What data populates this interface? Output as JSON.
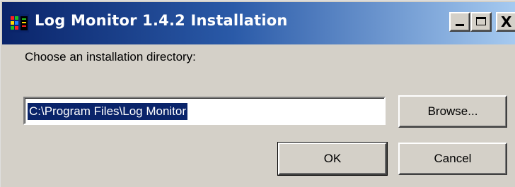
{
  "window": {
    "title": "Log Monitor 1.4.2 Installation",
    "icon": "app-icon",
    "controls": {
      "minimize_icon": "minimize-icon",
      "maximize_icon": "maximize-icon",
      "close_icon": "close-icon",
      "close_glyph": "X"
    }
  },
  "dialog": {
    "prompt": "Choose an installation directory:",
    "directory_value": "C:\\Program Files\\Log Monitor",
    "browse_label": "Browse...",
    "ok_label": "OK",
    "cancel_label": "Cancel"
  },
  "colors": {
    "titlebar_start": "#0a246a",
    "titlebar_end": "#a6caf0",
    "face": "#d4d0c8",
    "selection": "#0a246a"
  }
}
